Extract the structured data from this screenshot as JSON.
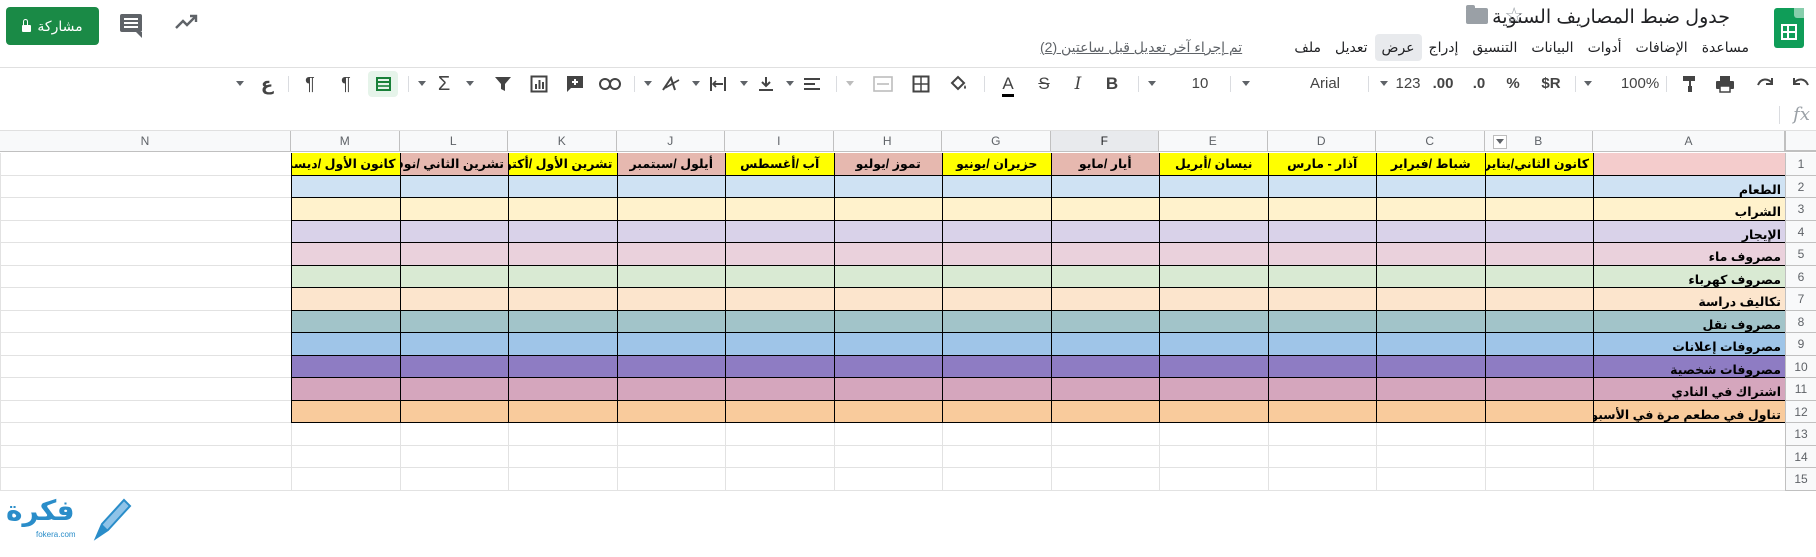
{
  "header": {
    "title": "جدول ضبط المصاريف السنوية",
    "last_edit": "تم إجراء آخر تعديل قبل ساعتين (2)",
    "share_label": "مشاركة",
    "menu": [
      "ملف",
      "تعديل",
      "عرض",
      "إدراج",
      "التنسيق",
      "البيانات",
      "أدوات",
      "الإضافات",
      "مساعدة"
    ],
    "active_menu": "عرض"
  },
  "toolbar": {
    "zoom": "100%",
    "currency": "$R",
    "percent": "%",
    "decimal_decrease": ".0",
    "decimal_increase": ".00",
    "more_formats": "123",
    "font": "Arial",
    "font_size": "10",
    "bold": "B",
    "italic": "I",
    "strike": "S",
    "text_color": "A",
    "input_tool": "ع",
    "icons": [
      "undo-icon",
      "redo-icon",
      "print-icon",
      "paint-format-icon",
      "borders-icon",
      "fill-color-icon",
      "merge-icon",
      "align-icon",
      "valign-icon",
      "wrap-icon",
      "rotate-icon",
      "link-icon",
      "comment-icon",
      "chart-icon",
      "filter-icon",
      "functions-icon",
      "ltr-icon",
      "rtl-icon"
    ]
  },
  "formula_bar": {
    "fx": "fx",
    "value": ""
  },
  "grid": {
    "columns": [
      "A",
      "B",
      "C",
      "D",
      "E",
      "F",
      "G",
      "H",
      "I",
      "J",
      "K",
      "L",
      "M",
      "N"
    ],
    "selected_column": "F",
    "rows": [
      "1",
      "2",
      "3",
      "4",
      "5",
      "6",
      "7",
      "8",
      "9",
      "10",
      "11",
      "12",
      "13",
      "14",
      "15"
    ],
    "months": [
      "كانون الثاني/يناير",
      "شباط /فبراير",
      "آذار - مارس",
      "نيسان /أبريل",
      "أيار /مايو",
      "حزيران /يونيو",
      "تموز /يوليو",
      "آب /أغسطس",
      "أيلول /سبتمبر",
      "تشرين الأول /أكتوبر",
      "تشرين الثاني /نوفمبر",
      "كانون الأول /ديسمبر"
    ],
    "month_colors": [
      "#f4cccc",
      "#ffff00",
      "#ffff00",
      "#ffff00",
      "#ffff00",
      "#e6b8af",
      "#ffff00",
      "#e6b8af",
      "#ffff00",
      "#e6b8af",
      "#ffff00",
      "#e6b8af",
      "#ffff00"
    ],
    "categories": [
      "الطعام",
      "الشراب",
      "الإيجار",
      "مصروف ماء",
      "مصروف كهرباء",
      "تكاليف دراسة",
      "مصروف نقل",
      "مصروفات إعلانات",
      "مصروفات شخصية",
      "اشتراك في النادي",
      "تناول في مطعم مرة في الأسبوع"
    ],
    "row_colors": [
      "#cfe2f3",
      "#fff2cc",
      "#d9d2e9",
      "#ead1dc",
      "#d9ead3",
      "#fce5cd",
      "#a2c4c9",
      "#9fc5e8",
      "#8e7cc3",
      "#d5a6bd",
      "#f9cb9c"
    ]
  },
  "watermark": {
    "text": "فكرة",
    "sub": "fokera.com"
  }
}
